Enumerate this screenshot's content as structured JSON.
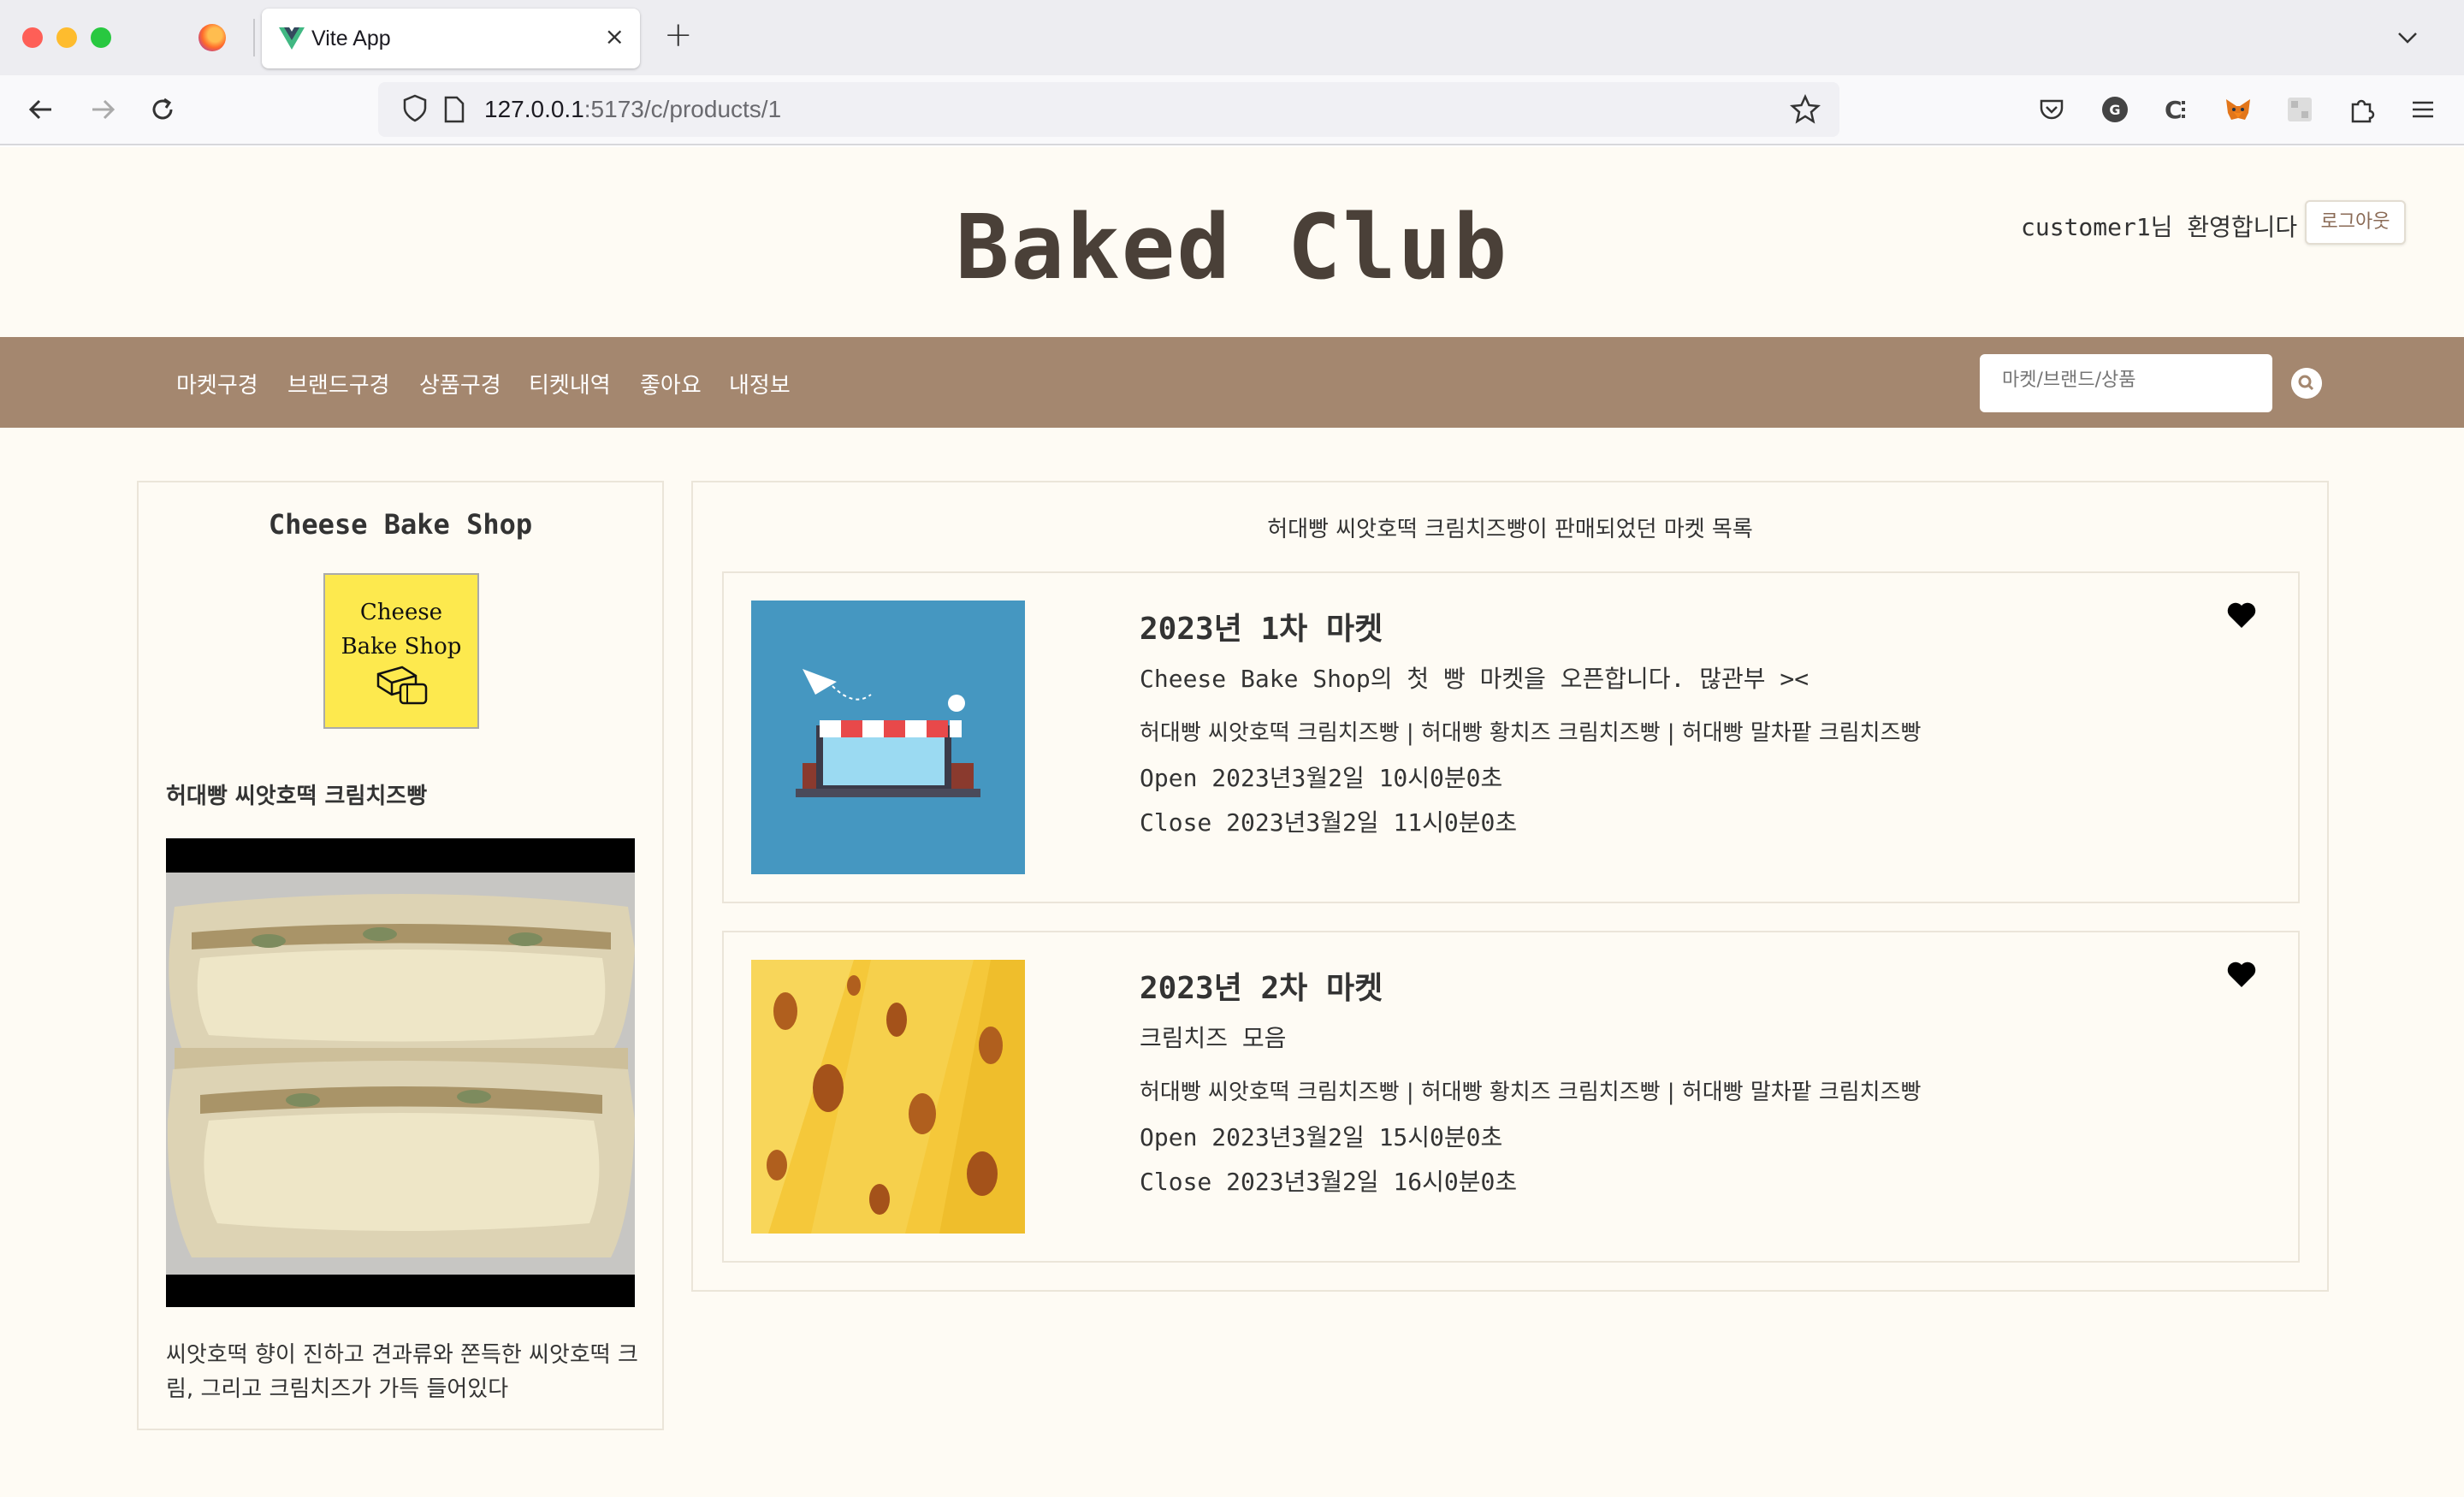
{
  "browser": {
    "tab_title": "Vite App",
    "tab_close": "×",
    "new_tab": "+",
    "url_host": "127.0.0.1",
    "url_rest": ":5173/c/products/1"
  },
  "header": {
    "brand": "Baked Club",
    "welcome": "customer1님 환영합니다",
    "logout": "로그아웃"
  },
  "menu": {
    "items": [
      "마켓구경",
      "브랜드구경",
      "상품구경",
      "티켓내역",
      "좋아요",
      "내정보"
    ],
    "search_placeholder": "마켓/브랜드/상품"
  },
  "shop": {
    "name": "Cheese Bake Shop",
    "logo_line1": "Cheese",
    "logo_line2": "Bake Shop",
    "product_title": "허대빵 씨앗호떡 크림치즈빵",
    "product_desc": "씨앗호떡 향이 진하고 견과류와 쫀득한 씨앗호떡 크림, 그리고 크림치즈가 가득 들어있다"
  },
  "markets": {
    "list_title": "허대빵 씨앗호떡 크림치즈빵이 판매되었던 마켓 목록",
    "items": [
      {
        "title": "2023년 1차 마켓",
        "desc": "Cheese Bake Shop의 첫 빵 마켓을 오픈합니다. 많관부 ><",
        "products": "허대빵 씨앗호떡 크림치즈빵 | 허대빵 황치즈 크림치즈빵 | 허대빵 말차팥 크림치즈빵",
        "open": "Open 2023년3월2일 10시0분0초",
        "close": "Close 2023년3월2일 11시0분0초",
        "liked": true
      },
      {
        "title": "2023년 2차 마켓",
        "desc": "크림치즈 모음",
        "products": "허대빵 씨앗호떡 크림치즈빵 | 허대빵 황치즈 크림치즈빵 | 허대빵 말차팥 크림치즈빵",
        "open": "Open 2023년3월2일 15시0분0초",
        "close": "Close 2023년3월2일 16시0분0초",
        "liked": true
      }
    ]
  },
  "colors": {
    "menu_bg": "#a4876f",
    "page_bg": "#fefbf4",
    "brand_text": "#4a4038",
    "logo_yellow": "#fde94e"
  }
}
